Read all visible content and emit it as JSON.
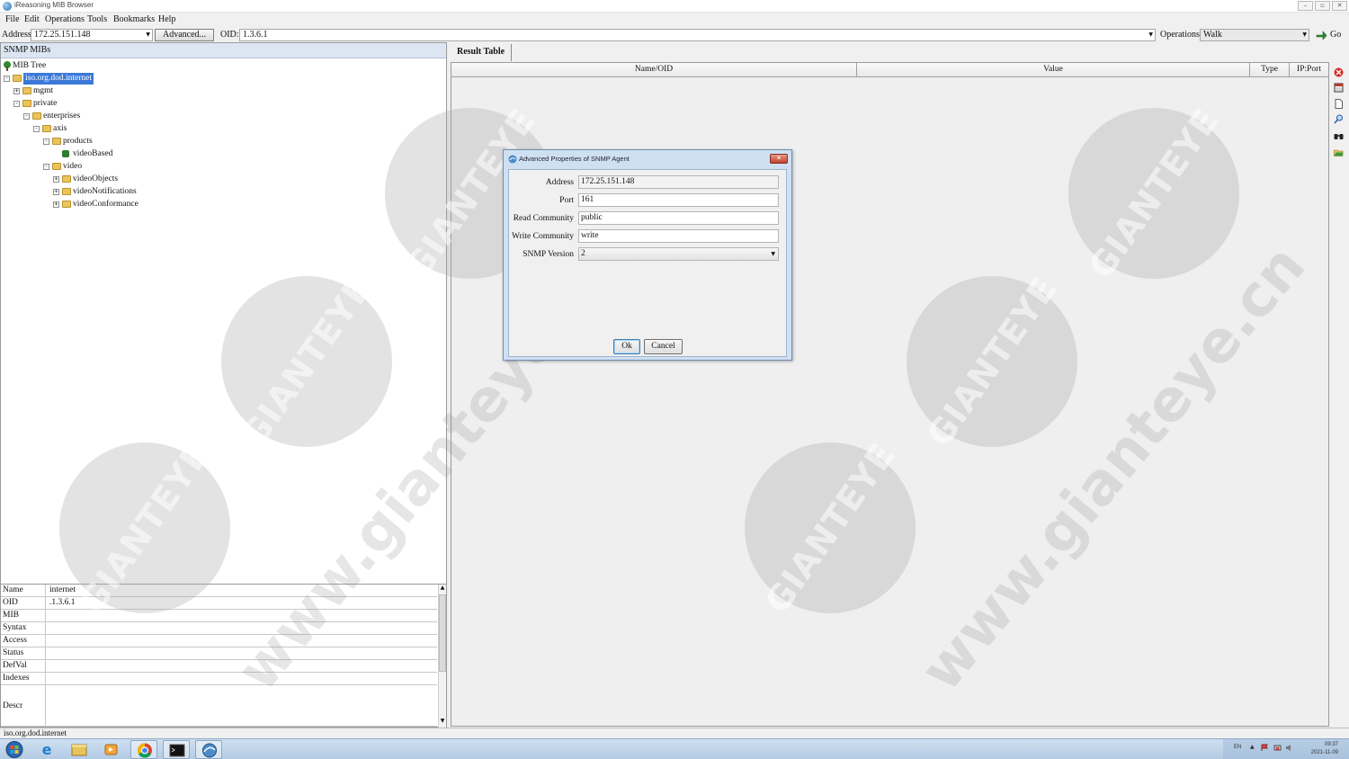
{
  "window": {
    "title": "iReasoning MIB Browser",
    "controls": [
      "–",
      "▫",
      "✕"
    ]
  },
  "menu": [
    "File",
    "Edit",
    "Operations",
    "Tools",
    "Bookmarks",
    "Help"
  ],
  "toolbar": {
    "address_label": "Address:",
    "address_value": "172.25.151.148",
    "advanced_label": "Advanced...",
    "oid_label": "OID:",
    "oid_value": "1.3.6.1",
    "operations_label": "Operations:",
    "operations_value": "Walk",
    "go_label": "Go"
  },
  "left": {
    "header": "SNMP MIBs",
    "tree": [
      {
        "label": "MIB Tree",
        "indent": 0,
        "exp": "",
        "icon": "tree"
      },
      {
        "label": "iso.org.dod.internet",
        "indent": 0,
        "exp": "-",
        "icon": "folder",
        "selected": true
      },
      {
        "label": "mgmt",
        "indent": 1,
        "exp": "+",
        "icon": "folder"
      },
      {
        "label": "private",
        "indent": 1,
        "exp": "-",
        "icon": "folder"
      },
      {
        "label": "enterprises",
        "indent": 2,
        "exp": "-",
        "icon": "folder"
      },
      {
        "label": "axis",
        "indent": 3,
        "exp": "-",
        "icon": "folder"
      },
      {
        "label": "products",
        "indent": 4,
        "exp": "-",
        "icon": "folder"
      },
      {
        "label": "videoBased",
        "indent": 5,
        "exp": "",
        "icon": "leaf"
      },
      {
        "label": "video",
        "indent": 4,
        "exp": "-",
        "icon": "folder"
      },
      {
        "label": "videoObjects",
        "indent": 5,
        "exp": "+",
        "icon": "folder"
      },
      {
        "label": "videoNotifications",
        "indent": 5,
        "exp": "+",
        "icon": "folder"
      },
      {
        "label": "videoConformance",
        "indent": 5,
        "exp": "+",
        "icon": "folder"
      }
    ],
    "properties": [
      {
        "key": "Name",
        "value": "internet"
      },
      {
        "key": "OID",
        "value": ".1.3.6.1"
      },
      {
        "key": "MIB",
        "value": ""
      },
      {
        "key": "Syntax",
        "value": ""
      },
      {
        "key": "Access",
        "value": ""
      },
      {
        "key": "Status",
        "value": ""
      },
      {
        "key": "DefVal",
        "value": ""
      },
      {
        "key": "Indexes",
        "value": ""
      },
      {
        "key": "Descr",
        "value": ""
      }
    ]
  },
  "right": {
    "tab": "Result Table",
    "columns": [
      "Name/OID",
      "Value",
      "Type",
      "IP:Port"
    ]
  },
  "dialog": {
    "title": "Advanced Properties of SNMP Agent",
    "close": "✕",
    "fields": {
      "address_label": "Address",
      "address_value": "172.25.151.148",
      "port_label": "Port",
      "port_value": "161",
      "read_label": "Read Community",
      "read_value": "public",
      "write_label": "Write Community",
      "write_value": "write",
      "version_label": "SNMP Version",
      "version_value": "2"
    },
    "ok": "Ok",
    "cancel": "Cancel"
  },
  "status": "iso.org.dod.internet",
  "taskbar": {
    "apps": [
      "start-orb",
      "ie",
      "explorer",
      "media-player",
      "chrome",
      "cmd",
      "mib-browser"
    ],
    "tray_lang": "EN",
    "time": "09:37",
    "date": "2021-11-09"
  },
  "watermark": {
    "logo": "GIANTEYE",
    "url": "www.gianteye.cn"
  },
  "colors": {
    "selection": "#3b79d8",
    "dialog_frame": "#cfe0f3",
    "taskbar": "#b3cbe4",
    "folder": "#e8c45a"
  }
}
